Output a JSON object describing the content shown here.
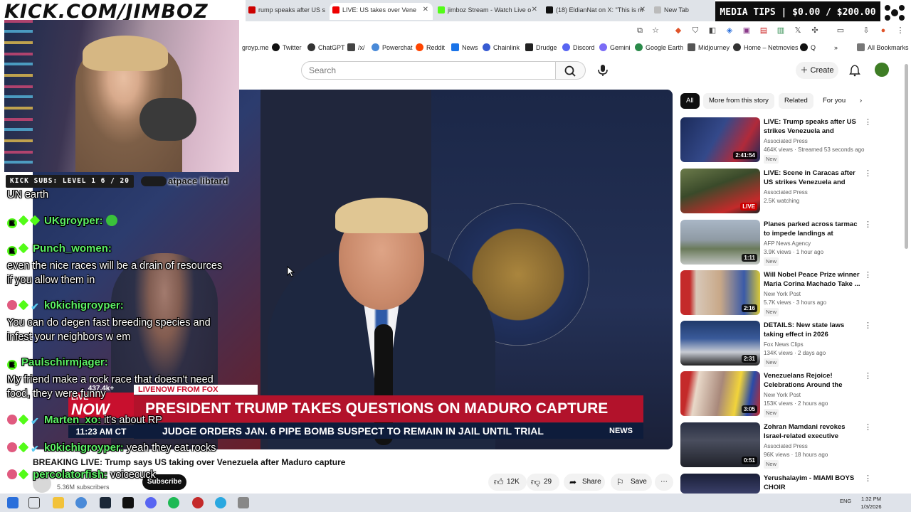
{
  "overlay": {
    "banner_url": "KICK.COM/JIMBOZ",
    "media_tips": "MEDIA TIPS | $0.00 / $200.00",
    "kick_subs": "KICK SUBS: LEVEL 1 6 / 20",
    "kick_extra": "atpace libtard"
  },
  "browser": {
    "tabs": [
      {
        "label": "rump speaks after US s"
      },
      {
        "label": "LIVE: US takes over Vene"
      },
      {
        "label": "jimboz Stream - Watch Live o"
      },
      {
        "label": "(18) EldianNat on X: \"This is m"
      },
      {
        "label": "New Tab"
      }
    ],
    "bookmarks": [
      {
        "label": "groyp.me",
        "icon": "globe-icon"
      },
      {
        "label": "Twitter",
        "icon": "x-logo-icon"
      },
      {
        "label": "ChatGPT",
        "icon": "chatgpt-icon"
      },
      {
        "label": "/x/",
        "icon": "grid-icon"
      },
      {
        "label": "Powerchat",
        "icon": "powerchat-icon"
      },
      {
        "label": "Reddit",
        "icon": "reddit-icon"
      },
      {
        "label": "News",
        "icon": "news-icon"
      },
      {
        "label": "Chainlink",
        "icon": "chainlink-icon"
      },
      {
        "label": "Drudge",
        "icon": "drudge-icon"
      },
      {
        "label": "Discord",
        "icon": "discord-icon"
      },
      {
        "label": "Gemini",
        "icon": "gemini-icon"
      },
      {
        "label": "Google Earth",
        "icon": "google-earth-icon"
      },
      {
        "label": "Midjourney",
        "icon": "midjourney-icon"
      },
      {
        "label": "Home – Netmovies",
        "icon": "play-icon"
      },
      {
        "label": "Q",
        "icon": "q-icon"
      }
    ],
    "all_bookmarks": "All Bookmarks"
  },
  "youtube": {
    "search_placeholder": "Search",
    "create_label": "Create",
    "video_title": "BREAKING LIVE: Trump says US taking over Venezuela after Maduro capture",
    "channel_subs": "5.36M subscribers",
    "subscribe": "Subscribe",
    "likes": "12K",
    "dislikes": "29",
    "share": "Share",
    "save": "Save",
    "chips": [
      "All",
      "More from this story",
      "Related",
      "For you"
    ],
    "recommendations": [
      {
        "title": "LIVE: Trump speaks after US strikes Venezuela and capture...",
        "channel": "Associated Press",
        "meta": "464K views · Streamed 53 seconds ago",
        "badge": "New",
        "duration": "2:41:54",
        "thumb": "thumb-trump-podium"
      },
      {
        "title": "LIVE: Scene in Caracas after US strikes Venezuela and says ...",
        "channel": "Associated Press",
        "meta": "2.5K watching",
        "badge": "",
        "duration": "LIVE",
        "thumb": "thumb-caracas"
      },
      {
        "title": "Planes parked across tarmac to impede landings at Venezuela...",
        "channel": "AFP News Agency",
        "meta": "3.9K views · 1 hour ago",
        "badge": "New",
        "duration": "1:11",
        "thumb": "thumb-tarmac"
      },
      {
        "title": "Will Nobel Peace Prize winner Maria Corina Machado Take ...",
        "channel": "New York Post",
        "meta": "5.7K views · 3 hours ago",
        "badge": "New",
        "duration": "2:16",
        "thumb": "thumb-machado"
      },
      {
        "title": "DETAILS: New state laws taking effect in 2026",
        "channel": "Fox News Clips",
        "meta": "134K views · 2 days ago",
        "badge": "New",
        "duration": "2:31",
        "thumb": "thumb-fox"
      },
      {
        "title": "Venezuelans Rejoice! Celebrations Around the World...",
        "channel": "New York Post",
        "meta": "153K views · 2 hours ago",
        "badge": "New",
        "duration": "3:05",
        "thumb": "thumb-celebration"
      },
      {
        "title": "Zohran Mamdani revokes Israel-related executive orders of Eri...",
        "channel": "Associated Press",
        "meta": "96K views · 18 hours ago",
        "badge": "New",
        "duration": "0:51",
        "thumb": "thumb-mamdani"
      },
      {
        "title": "Yerushalayim - MIAMI BOYS CHOIR",
        "channel": "",
        "meta": "",
        "badge": "",
        "duration": "",
        "thumb": "thumb-choir"
      }
    ]
  },
  "broadcast": {
    "live_label": "LIVE",
    "now_label": "NOW",
    "view_count": "437.4k+",
    "livenow": "LIVENOW FROM FOX",
    "headline": "PRESIDENT TRUMP TAKES QUESTIONS ON MADURO CAPTURE",
    "time": "11:23 AM CT",
    "ticker": "JUDGE ORDERS JAN. 6 PIPE BOMB SUSPECT TO REMAIN IN JAIL UNTIL TRIAL",
    "news": "NEWS"
  },
  "chat": [
    {
      "user": "",
      "msg": "UN earth",
      "badges": []
    },
    {
      "user": "UKgroyper:",
      "msg": "",
      "badges": [
        "k",
        "s",
        "s"
      ]
    },
    {
      "user": "Punch_women:",
      "msg": "",
      "badges": [
        "k",
        "s"
      ]
    },
    {
      "user": "",
      "msg": "even the nice races will be a drain of resources",
      "badges": []
    },
    {
      "user": "",
      "msg": "if you allow them in",
      "badges": []
    },
    {
      "user": "k0kichigroyper:",
      "msg": "",
      "badges": [
        "p",
        "s",
        "t"
      ]
    },
    {
      "user": "",
      "msg": "You can do degen fast breeding species and",
      "badges": []
    },
    {
      "user": "",
      "msg": "infest your neighbors w em",
      "badges": []
    },
    {
      "user": "Paulschirmjager:",
      "msg": "",
      "badges": [
        "k"
      ]
    },
    {
      "user": "",
      "msg": "My friend make a rock race that doesn't need",
      "badges": []
    },
    {
      "user": "",
      "msg": "food, they were funny",
      "badges": []
    },
    {
      "user": "Marten_xo:",
      "msg": "it's about RP",
      "badges": [
        "p",
        "s",
        "t"
      ]
    },
    {
      "user": "k0kichigroyper:",
      "msg": "yeah they eat rocks",
      "badges": [
        "p",
        "s",
        "t"
      ]
    },
    {
      "user": "percolatorfish:",
      "msg": "voicecuck",
      "badges": [
        "p",
        "s"
      ]
    }
  ],
  "taskbar": {
    "lang": "ENG",
    "clock_time": "1:32 PM",
    "clock_date": "1/3/2026"
  }
}
